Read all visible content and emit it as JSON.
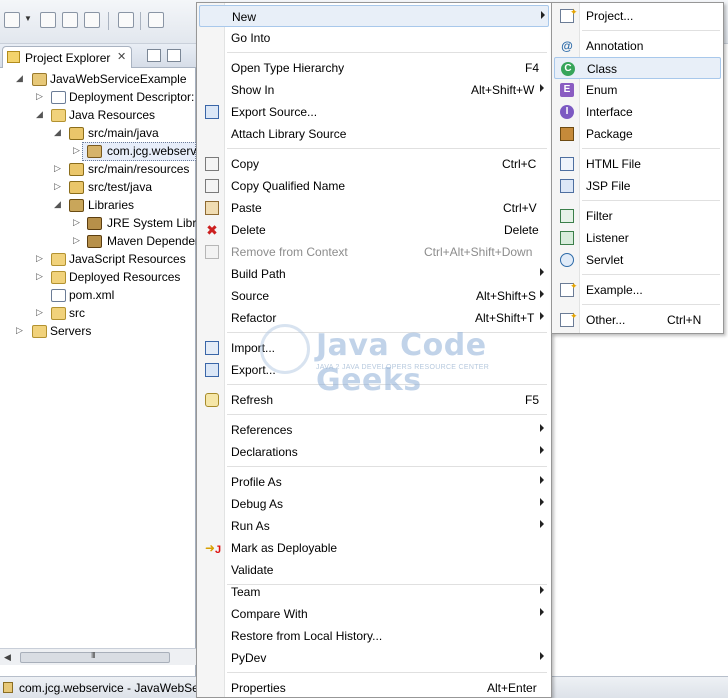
{
  "explorer": {
    "tab_label": "Project Explorer",
    "tree": [
      {
        "label": "JavaWebServiceExample",
        "kind": "project",
        "expanded": true
      },
      {
        "label": "Deployment Descriptor:",
        "kind": "file"
      },
      {
        "label": "Java Resources",
        "kind": "folder",
        "expanded": true
      },
      {
        "label": "src/main/java",
        "kind": "pkgfolder",
        "expanded": true
      },
      {
        "label": "com.jcg.webserv",
        "kind": "package",
        "selected": true
      },
      {
        "label": "src/main/resources",
        "kind": "pkgfolder"
      },
      {
        "label": "src/test/java",
        "kind": "pkgfolder"
      },
      {
        "label": "Libraries",
        "kind": "lib",
        "expanded": true
      },
      {
        "label": "JRE System Libra",
        "kind": "jar"
      },
      {
        "label": "Maven Depender",
        "kind": "jar"
      },
      {
        "label": "JavaScript Resources",
        "kind": "folder"
      },
      {
        "label": "Deployed Resources",
        "kind": "folder"
      },
      {
        "label": "pom.xml",
        "kind": "file"
      },
      {
        "label": "src",
        "kind": "folder"
      },
      {
        "label": "Servers",
        "kind": "folder"
      }
    ],
    "scroll_grip": "III"
  },
  "status": {
    "text": "com.jcg.webservice - JavaWebSer"
  },
  "context_menu": {
    "items": [
      {
        "label": "New",
        "submenu": true,
        "highlighted": true
      },
      {
        "label": "Go Into"
      },
      {
        "label": "Open Type Hierarchy",
        "shortcut": "F4"
      },
      {
        "label": "Show In",
        "shortcut": "Alt+Shift+W",
        "submenu": true
      },
      {
        "label": "Export Source...",
        "icon": "export-icon"
      },
      {
        "label": "Attach Library Source"
      },
      {
        "label": "Copy",
        "shortcut": "Ctrl+C",
        "icon": "copy-icon"
      },
      {
        "label": "Copy Qualified Name",
        "icon": "copy-qualified-icon"
      },
      {
        "label": "Paste",
        "shortcut": "Ctrl+V",
        "icon": "paste-icon"
      },
      {
        "label": "Delete",
        "shortcut": "Delete",
        "icon": "delete-icon"
      },
      {
        "label": "Remove from Context",
        "shortcut": "Ctrl+Alt+Shift+Down",
        "disabled": true,
        "icon": "remove-context-icon"
      },
      {
        "label": "Build Path",
        "submenu": true
      },
      {
        "label": "Source",
        "shortcut": "Alt+Shift+S",
        "submenu": true
      },
      {
        "label": "Refactor",
        "shortcut": "Alt+Shift+T",
        "submenu": true
      },
      {
        "label": "Import...",
        "icon": "import-icon"
      },
      {
        "label": "Export...",
        "icon": "export-icon"
      },
      {
        "label": "Refresh",
        "shortcut": "F5",
        "icon": "refresh-icon"
      },
      {
        "label": "References",
        "submenu": true
      },
      {
        "label": "Declarations",
        "submenu": true
      },
      {
        "label": "Profile As",
        "submenu": true
      },
      {
        "label": "Debug As",
        "submenu": true
      },
      {
        "label": "Run As",
        "submenu": true
      },
      {
        "label": "Mark as Deployable",
        "icon": "deploy-icon"
      },
      {
        "label": "Validate"
      },
      {
        "label": "Team",
        "submenu": true
      },
      {
        "label": "Compare With",
        "submenu": true
      },
      {
        "label": "Restore from Local History..."
      },
      {
        "label": "PyDev",
        "submenu": true
      },
      {
        "label": "Properties",
        "shortcut": "Alt+Enter"
      }
    ]
  },
  "new_submenu": {
    "items": [
      {
        "label": "Project...",
        "icon": "new-project-icon"
      },
      {
        "label": "Annotation",
        "icon": "annotation-icon"
      },
      {
        "label": "Class",
        "icon": "class-icon",
        "highlighted": true
      },
      {
        "label": "Enum",
        "icon": "enum-icon"
      },
      {
        "label": "Interface",
        "icon": "interface-icon"
      },
      {
        "label": "Package",
        "icon": "package-icon"
      },
      {
        "label": "HTML File",
        "icon": "html-file-icon"
      },
      {
        "label": "JSP File",
        "icon": "jsp-file-icon"
      },
      {
        "label": "Filter",
        "icon": "filter-icon"
      },
      {
        "label": "Listener",
        "icon": "listener-icon"
      },
      {
        "label": "Servlet",
        "icon": "servlet-icon"
      },
      {
        "label": "Example...",
        "icon": "example-icon"
      },
      {
        "label": "Other...",
        "shortcut": "Ctrl+N",
        "icon": "other-icon"
      }
    ]
  },
  "watermark": {
    "title": "Java Code Geeks",
    "subtitle": "JAVA 2 JAVA DEVELOPERS RESOURCE CENTER"
  },
  "icon_glyphs": {
    "annotation": "@",
    "class": "C",
    "enum": "E",
    "interface": "I",
    "delete": "✖",
    "deploy_arrow": "➜",
    "deploy_j": "J",
    "sparkle": "✦",
    "expanded": "◢",
    "collapsed": "▷",
    "close": "✕"
  }
}
